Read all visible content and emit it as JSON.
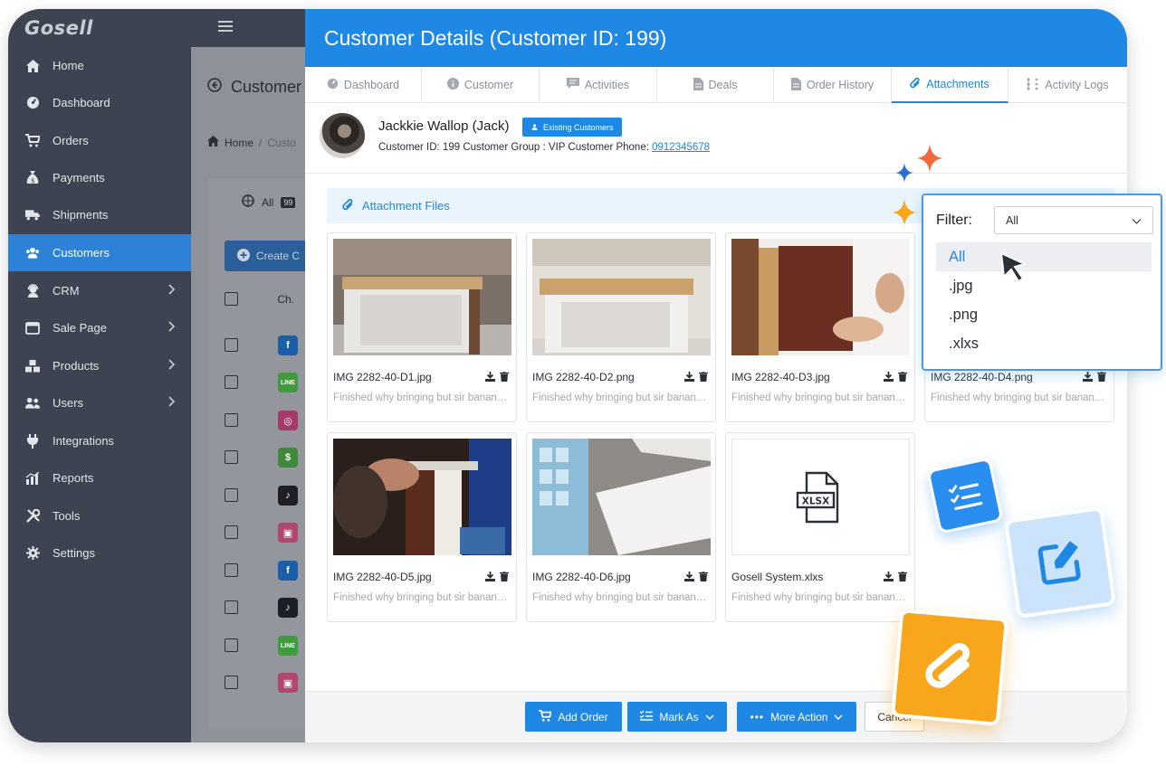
{
  "app": {
    "logo": "Gosell"
  },
  "sidebar": {
    "items": [
      {
        "label": "Home",
        "icon": "home-icon"
      },
      {
        "label": "Dashboard",
        "icon": "dashboard-icon"
      },
      {
        "label": "Orders",
        "icon": "cart-icon"
      },
      {
        "label": "Payments",
        "icon": "money-bag-icon"
      },
      {
        "label": "Shipments",
        "icon": "truck-icon"
      },
      {
        "label": "Customers",
        "icon": "users-icon",
        "active": true
      },
      {
        "label": "CRM",
        "icon": "headset-icon"
      },
      {
        "label": "Sale Page",
        "icon": "browser-icon"
      },
      {
        "label": "Products",
        "icon": "boxes-icon"
      },
      {
        "label": "Users",
        "icon": "user-group-icon"
      },
      {
        "label": "Integrations",
        "icon": "plug-icon"
      },
      {
        "label": "Reports",
        "icon": "chart-icon"
      },
      {
        "label": "Tools",
        "icon": "tools-icon"
      },
      {
        "label": "Settings",
        "icon": "gear-icon"
      }
    ]
  },
  "background": {
    "title": "Customer",
    "breadcrumb_home": "Home",
    "breadcrumb_next": "Custo",
    "all_tab": "All",
    "all_count": "99",
    "create_button": "Create C",
    "channel_header": "Ch."
  },
  "modal": {
    "title": "Customer Details (Customer ID: 199)",
    "tabs": [
      {
        "label": "Dashboard",
        "icon": "dashboard-icon"
      },
      {
        "label": "Customer",
        "icon": "info-icon"
      },
      {
        "label": "Activities",
        "icon": "comment-icon"
      },
      {
        "label": "Deals",
        "icon": "document-icon"
      },
      {
        "label": "Order History",
        "icon": "document-icon"
      },
      {
        "label": "Attachments",
        "icon": "paperclip-icon",
        "active": true
      },
      {
        "label": "Activity Logs",
        "icon": "timeline-icon"
      }
    ],
    "customer": {
      "name": "Jackkie Wallop (Jack)",
      "badge": "Existing Customers",
      "info": "Customer ID: 199 Customer Group : VIP  Customer Phone: ",
      "phone": "0912345678"
    },
    "attachments_title": "Attachment Files",
    "files": [
      {
        "name": "IMG 2282-40-D1.jpg",
        "desc": "Finished why bringing but sir bananas."
      },
      {
        "name": "IMG 2282-40-D2.png",
        "desc": "Finished why bringing but sir bananas."
      },
      {
        "name": "IMG 2282-40-D3.jpg",
        "desc": "Finished why bringing but sir bananas."
      },
      {
        "name": "IMG 2282-40-D4.png",
        "desc": "Finished why bringing but sir bananas."
      },
      {
        "name": "IMG 2282-40-D5.jpg",
        "desc": "Finished why bringing but sir bananas."
      },
      {
        "name": "IMG 2282-40-D6.jpg",
        "desc": "Finished why bringing but sir bananas."
      },
      {
        "name": "Gosell System.xlxs",
        "desc": "Finished why bringing but sir bananas.",
        "file_badge": "XLSX"
      }
    ],
    "footer": {
      "add_order": "Add Order",
      "mark_as": "Mark As",
      "more_action": "More Action",
      "cancel": "Cancel"
    }
  },
  "filter": {
    "label": "Filter:",
    "selected": "All",
    "options": [
      "All",
      ".jpg",
      ".png",
      ".xlxs"
    ]
  },
  "colors": {
    "primary": "#1f88e5",
    "sidebar": "#3d4350",
    "accent_orange": "#f8a61b",
    "accent_star": "#f26a3b"
  }
}
